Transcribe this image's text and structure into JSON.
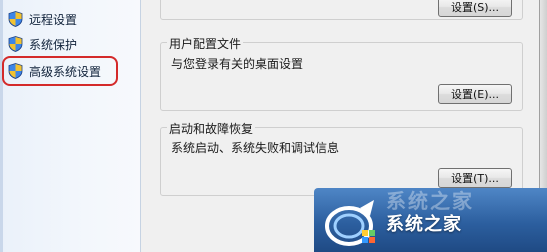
{
  "sidebar": {
    "items": [
      {
        "label": "远程设置",
        "icon": "uac-shield-icon"
      },
      {
        "label": "系统保护",
        "icon": "uac-shield-icon"
      },
      {
        "label": "高级系统设置",
        "icon": "uac-shield-icon",
        "highlighted": true
      }
    ],
    "highlight_color": "#d42a2a"
  },
  "performance": {
    "button": "设置(S)..."
  },
  "user_profiles": {
    "title": "用户配置文件",
    "description": "与您登录有关的桌面设置",
    "button": "设置(E)..."
  },
  "startup_recovery": {
    "title": "启动和故障恢复",
    "description": "系统启动、系统失败和调试信息",
    "button": "设置(T)..."
  },
  "watermark": {
    "text": "系统之家",
    "faded_text": "系统之家",
    "logo": "xitongzhijia-logo",
    "color": "#2c5f9f"
  },
  "colors": {
    "panel_background": "#f0f0f0",
    "sidebar_background": "#eaf1fa"
  }
}
